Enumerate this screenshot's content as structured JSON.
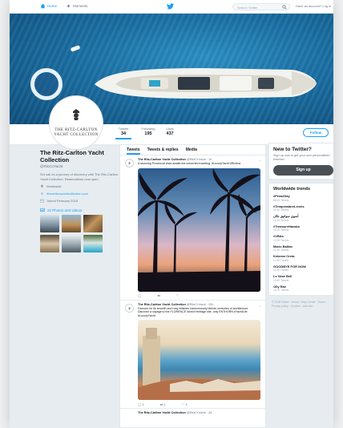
{
  "colors": {
    "accent": "#1da1f2",
    "signup": "#4a4f55"
  },
  "nav": {
    "home": "Home",
    "moments": "Moments",
    "search_placeholder": "Search Twitter",
    "login": "Have an account? Log in"
  },
  "header": {
    "image": "luxury yacht from above on blue sea"
  },
  "avatar": {
    "brand": "THE RITZ-CARLTON YACHT COLLECTION"
  },
  "stats": [
    {
      "label": "Tweets",
      "value": "34"
    },
    {
      "label": "Following",
      "value": "195"
    },
    {
      "label": "Likes",
      "value": "437"
    }
  ],
  "follow_label": "Follow",
  "profile": {
    "name": "The Ritz-Carlton Yacht Collection",
    "handle": "@RitzCrYacht",
    "bio": "Set sail on a journey of discovery with The Ritz-Carlton Yacht Collection. Reservations now open.",
    "location": "Worldwide",
    "website": "ritzcarltonyachtcollection.com",
    "joined": "Joined February 2018",
    "photos_label": "22 Photos and videos"
  },
  "tabs": [
    "Tweets",
    "Tweets & replies",
    "Media"
  ],
  "tweets": [
    {
      "author": "The Ritz-Carlton Yacht Collection",
      "handle": "@RitzCrYacht · 1h",
      "text": "A stunning Provencal vista awaits the unhurried traveling. #LuxuryYacht #Riviera"
    },
    {
      "author": "The Ritz-Carlton Yacht Collection",
      "handle": "@RitzCrYacht · 20h",
      "text": "Famous for its smooth and rosy hillsides harmoniously blends centuries of architecture. Discover a voyage to the FLORENCE World Heritage site, only ENTHORN #YachtLife #LuxuryYacht"
    },
    {
      "author": "The Ritz-Carlton Yacht Collection",
      "handle": "@RitzCrYacht · 2d",
      "text": ""
    }
  ],
  "newto": {
    "title": "New to Twitter?",
    "text": "Sign up now to get your own personalized timeline!",
    "button": "Sign up"
  },
  "trends": {
    "title": "Worldwide trends",
    "items": [
      {
        "tag": "#PrimeDay",
        "count": "86.5K Tweets"
      },
      {
        "tag": "#TemperatureLevels",
        "count": "21.4K Tweets"
      },
      {
        "tag": "أسوي سوانيق نكان",
        "count": "15.3K Tweets"
      },
      {
        "tag": "#TreasureHacaks",
        "count": "15.1K Tweets"
      },
      {
        "tag": "#VBAs",
        "count": "12.9K Tweets"
      },
      {
        "tag": "Mario Balfan",
        "count": "12.3K Tweets"
      },
      {
        "tag": "Keberar Creta",
        "count": "11.5K Tweets"
      },
      {
        "tag": "GOODBYE FOR NOW",
        "count": "11.0K Tweets"
      },
      {
        "tag": "Le Vase Bell",
        "count": "10.4K Tweets"
      },
      {
        "tag": "Olly Rae",
        "count": "10.1K Tweets"
      }
    ]
  },
  "footer": "© 2018 Twitter · About · Help Center · Terms · Privacy policy · Cookies · Ads info"
}
